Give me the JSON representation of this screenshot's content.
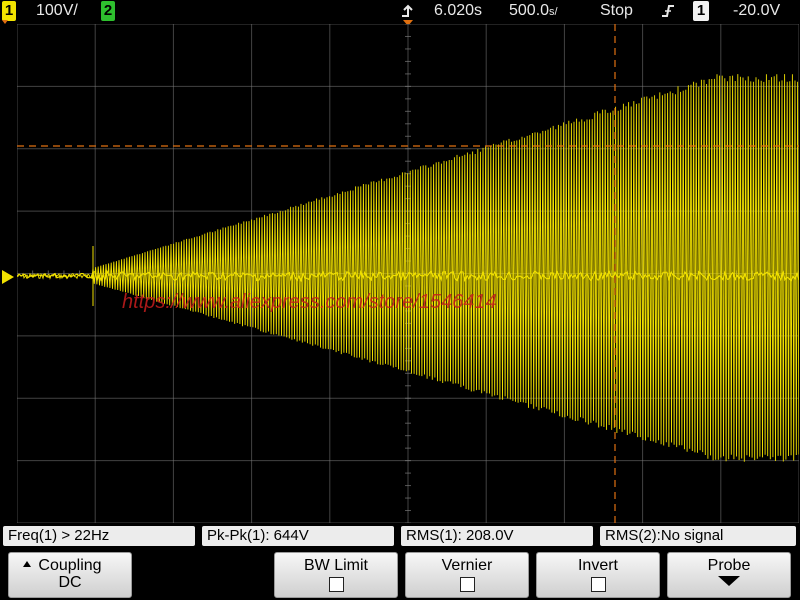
{
  "status_bar": {
    "ch1_label": "1",
    "ch1_scale": "100V/",
    "ch2_label": "2",
    "timebase_delay": "6.020s",
    "timebase_scale": "500.0",
    "timebase_unit": "s/",
    "run_state": "Stop",
    "trigger_source": "1",
    "trigger_level": "-20.0V"
  },
  "measurements": [
    {
      "label": "Freq(1) > 22Hz"
    },
    {
      "label": "Pk-Pk(1): 644V"
    },
    {
      "label": "RMS(1): 208.0V"
    },
    {
      "label": "RMS(2):No signal"
    }
  ],
  "softkeys": {
    "coupling": {
      "label": "Coupling",
      "value": "DC"
    },
    "bw_limit": {
      "label": "BW Limit"
    },
    "vernier": {
      "label": "Vernier"
    },
    "invert": {
      "label": "Invert"
    },
    "probe": {
      "label": "Probe"
    }
  },
  "watermark": {
    "text": "https://www.aliexpress.com/store/1546414"
  },
  "colors": {
    "trace": "#f0e000",
    "grid": "#7a7a7a",
    "cursor": "#e07010",
    "watermark": "#c81e1e"
  }
}
